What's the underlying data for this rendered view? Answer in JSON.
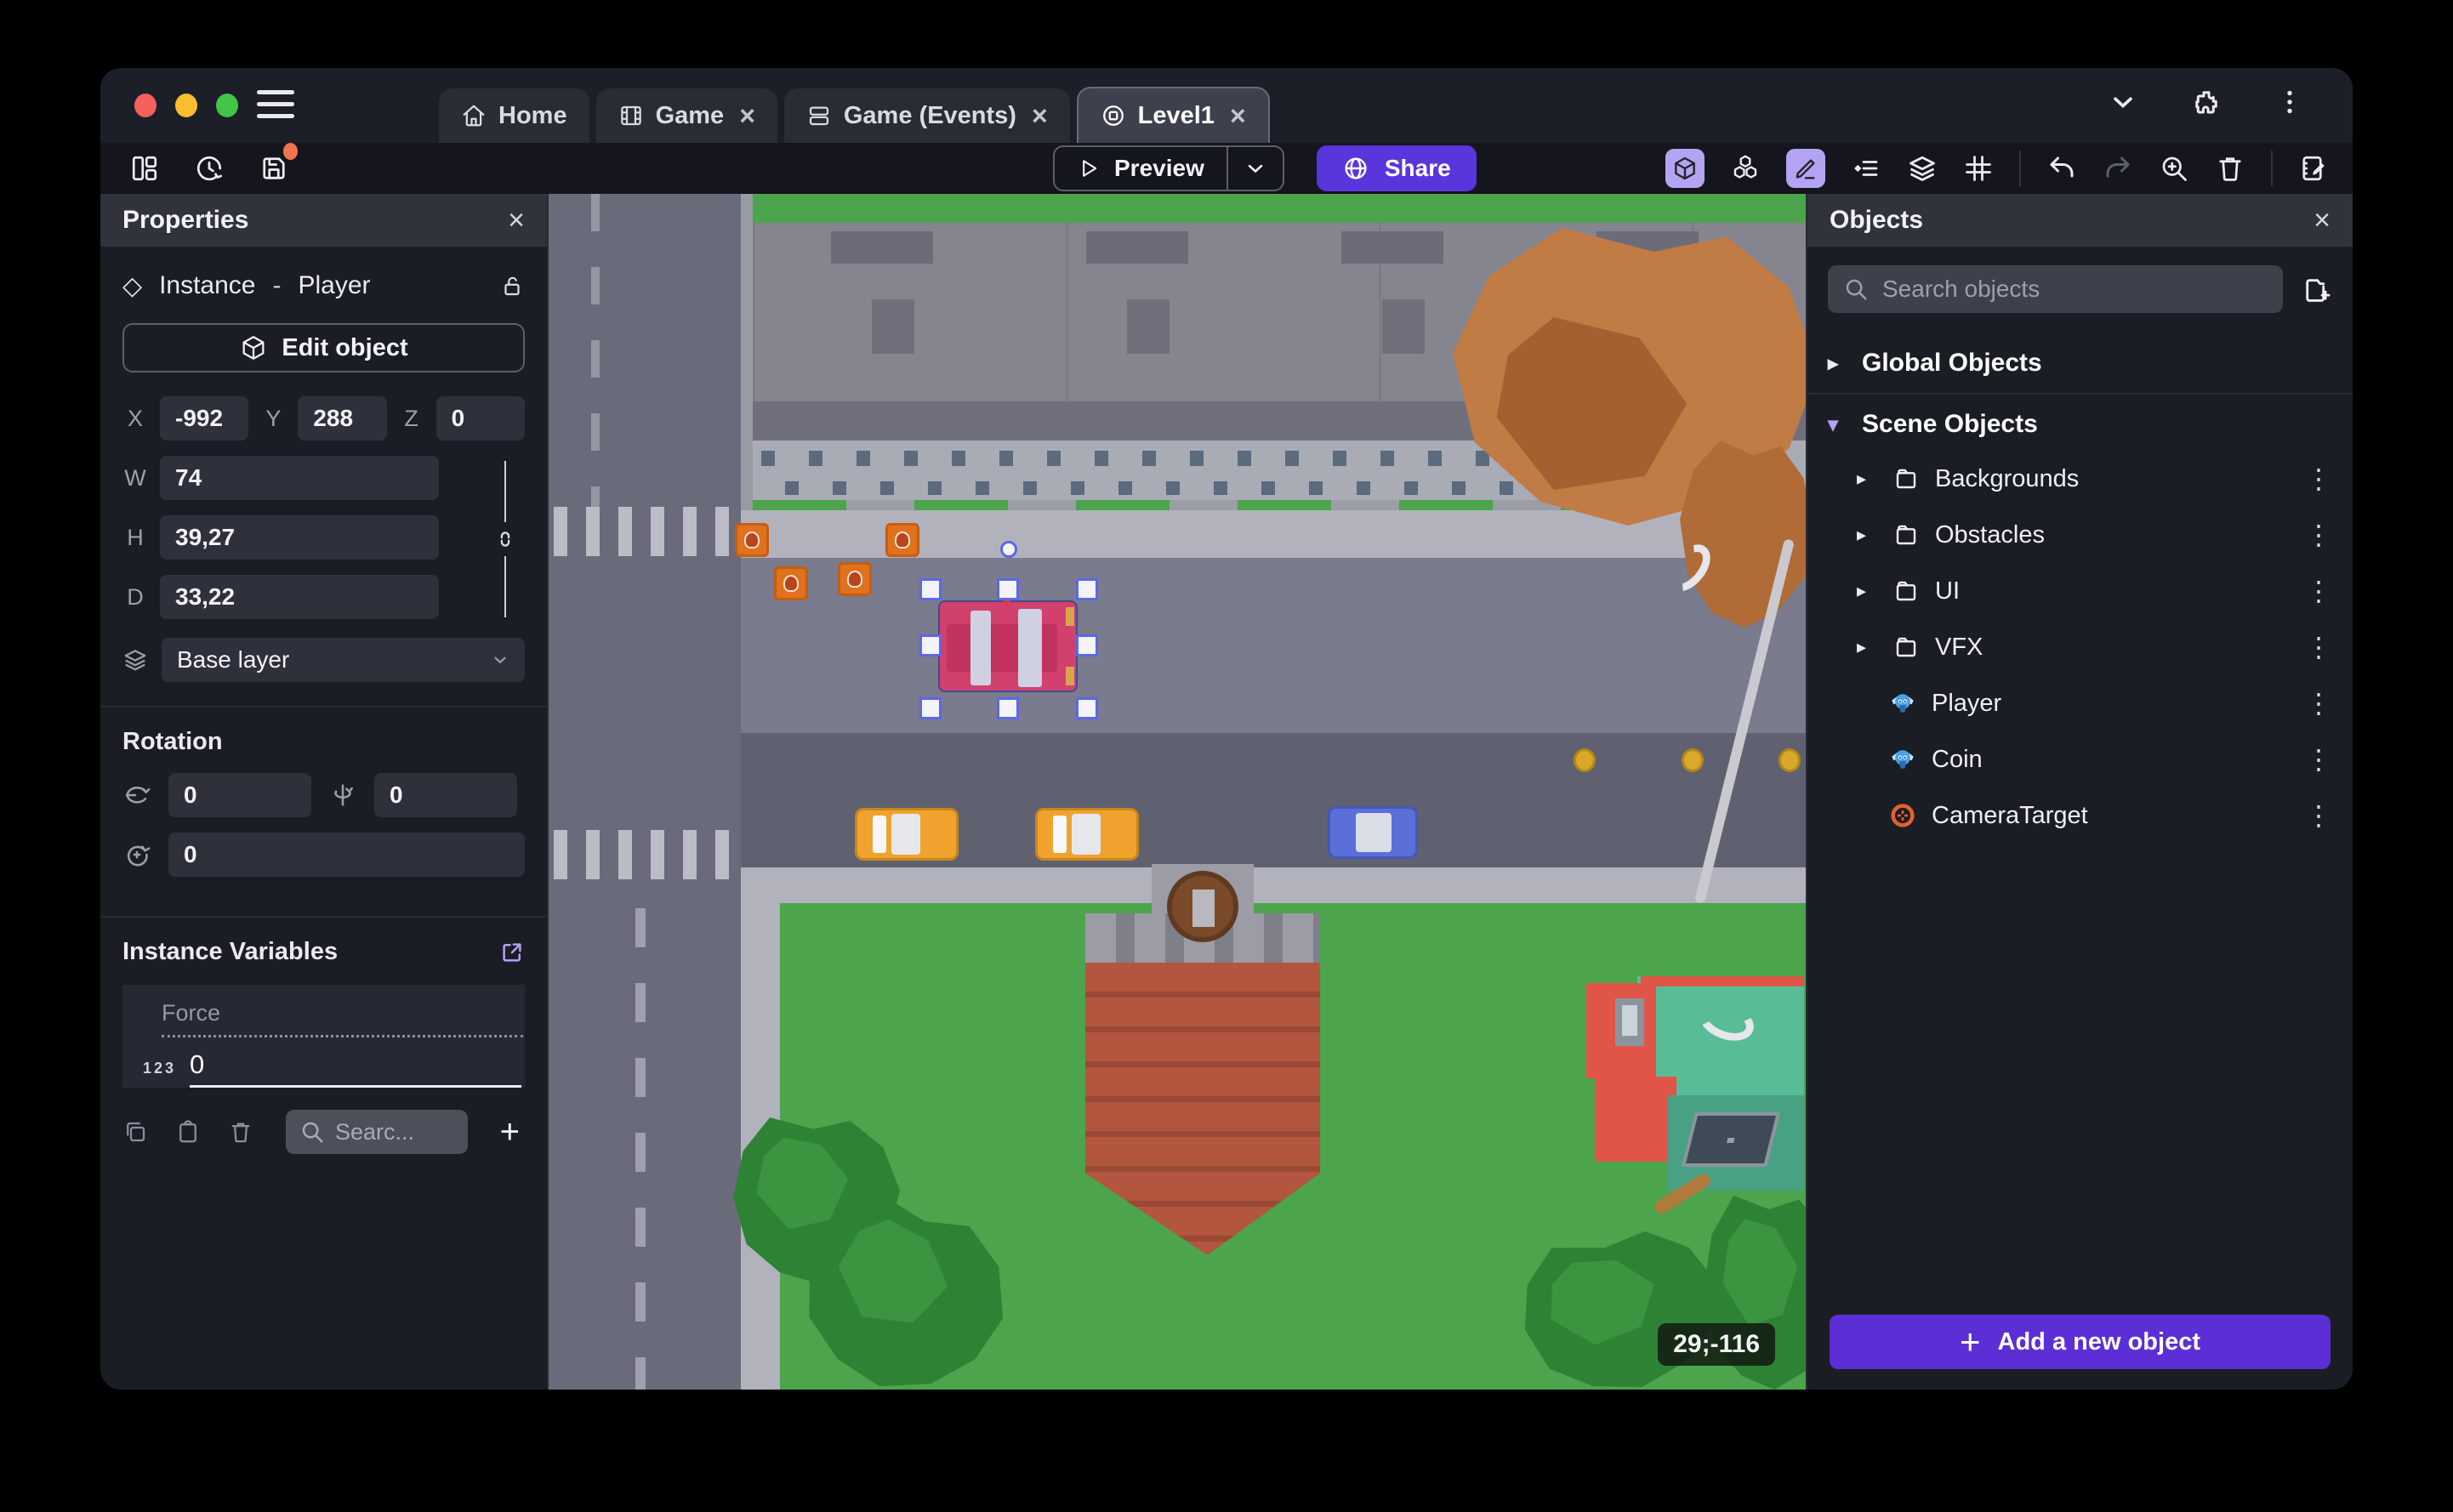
{
  "chrome": {
    "traffic_lights": {
      "close": "#f4605a",
      "minimize": "#f9bd2e",
      "maximize": "#43c645"
    },
    "tabs": [
      {
        "label": "Home",
        "icon": "home-icon",
        "closable": false,
        "active": false
      },
      {
        "label": "Game",
        "icon": "film-icon",
        "closable": true,
        "active": false
      },
      {
        "label": "Game (Events)",
        "icon": "events-icon",
        "closable": true,
        "active": false
      },
      {
        "label": "Level1",
        "icon": "scene-icon",
        "closable": true,
        "active": true
      }
    ],
    "close_glyph": "×"
  },
  "toolbar": {
    "preview_label": "Preview",
    "share_label": "Share",
    "left_icons": [
      "layout-panels-icon",
      "history-icon",
      "save-icon"
    ],
    "right_icons": [
      "cube-3d-icon",
      "objects-cubes-icon",
      "pencil-icon",
      "instance-list-icon",
      "layers-icon",
      "grid-icon",
      "undo-icon",
      "redo-icon",
      "zoom-in-icon",
      "trash-icon",
      "notebook-edit-icon"
    ],
    "active_icon_bg": "#b4a3f2",
    "share_color": "#5a35dc"
  },
  "properties": {
    "title": "Properties",
    "instance_type": "Instance",
    "separator": "-",
    "object_name": "Player",
    "edit_object_label": "Edit object",
    "position": [
      {
        "label": "X",
        "value": "-992"
      },
      {
        "label": "Y",
        "value": "288"
      },
      {
        "label": "Z",
        "value": "0"
      }
    ],
    "size": [
      {
        "label": "W",
        "value": "74"
      },
      {
        "label": "H",
        "value": "39,27"
      },
      {
        "label": "D",
        "value": "33,22"
      }
    ],
    "layer_value": "Base layer",
    "rotation_title": "Rotation",
    "rotation": [
      "0",
      "0",
      "0"
    ],
    "variables_title": "Instance Variables",
    "variable_name": "Force",
    "variable_type_badge": "123",
    "variable_value": "0",
    "variables_search_placeholder": "Searc..."
  },
  "objects": {
    "title": "Objects",
    "search_placeholder": "Search objects",
    "global_group_label": "Global Objects",
    "scene_group_label": "Scene Objects",
    "folders": [
      {
        "label": "Backgrounds"
      },
      {
        "label": "Obstacles"
      },
      {
        "label": "UI"
      },
      {
        "label": "VFX"
      }
    ],
    "items": [
      {
        "label": "Player",
        "icon": "monkey-icon"
      },
      {
        "label": "Coin",
        "icon": "monkey-icon"
      },
      {
        "label": "CameraTarget",
        "icon": "crosshair-icon"
      }
    ],
    "add_button_label": "Add a new object",
    "add_button_color": "#5b2ed6"
  },
  "canvas": {
    "cursor_coordinates": "29;-116",
    "selected_object": "Player",
    "colors": {
      "grass": "#4ca44c",
      "road_light": "#7a7b8d",
      "road_dark": "#5f6170",
      "road_vertical": "#6a6b7a",
      "sidewalk": "#b2b2bc",
      "building_roof": "#85858f",
      "taxi": "#efa32e",
      "car_blue": "#5b6fd8",
      "car_selected": "#d2406e",
      "coin": "#d9a929",
      "crate": "#e0711f",
      "tree": "#2e8234",
      "autumn_tree": "#c17b44",
      "tower_brick": "#b3563f",
      "teal_building": "#58bc96",
      "selection": "#5b67e8"
    }
  }
}
